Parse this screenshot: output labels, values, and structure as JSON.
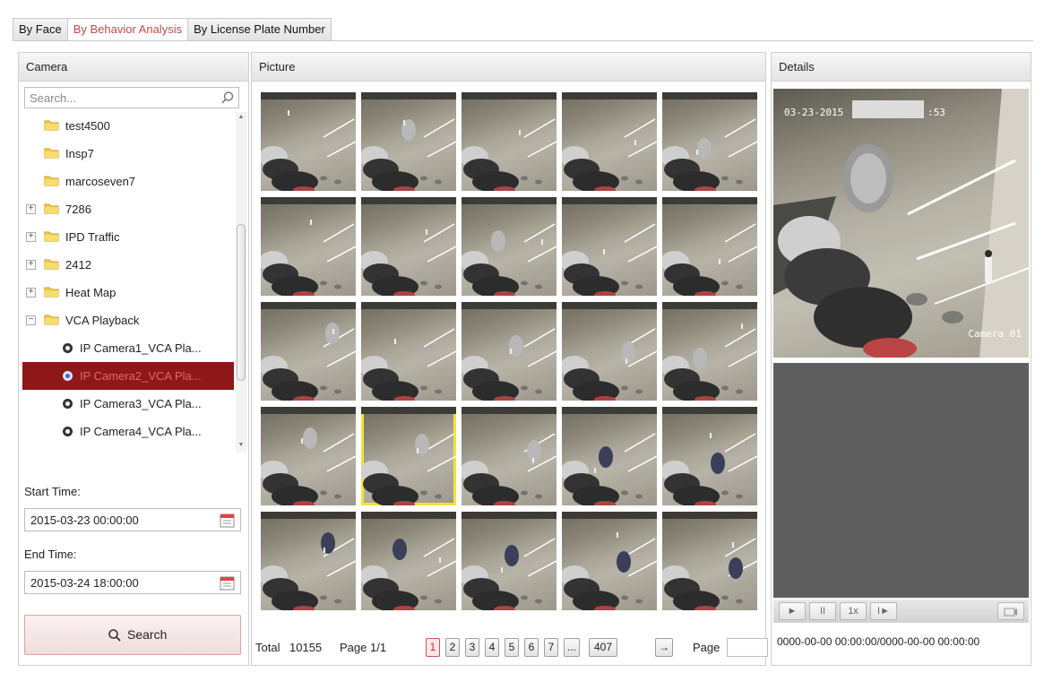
{
  "tabs": [
    {
      "label": "By Face"
    },
    {
      "label": "By Behavior Analysis"
    },
    {
      "label": "By License Plate Number"
    }
  ],
  "camera_panel": {
    "title": "Camera",
    "search_placeholder": "Search...",
    "tree": [
      {
        "label": "test4500",
        "type": "folder"
      },
      {
        "label": "Insp7",
        "type": "folder"
      },
      {
        "label": "marcoseven7",
        "type": "folder"
      },
      {
        "label": "7286",
        "type": "folder",
        "expander": "+"
      },
      {
        "label": "IPD Traffic",
        "type": "folder",
        "expander": "+"
      },
      {
        "label": "2412",
        "type": "folder",
        "expander": "+"
      },
      {
        "label": "Heat Map",
        "type": "folder",
        "expander": "+"
      },
      {
        "label": "VCA Playback",
        "type": "folder",
        "expander": "−"
      },
      {
        "label": "IP Camera1_VCA Pla...",
        "type": "camera"
      },
      {
        "label": "IP Camera2_VCA Pla...",
        "type": "camera",
        "selected": true
      },
      {
        "label": "IP Camera3_VCA Pla...",
        "type": "camera"
      },
      {
        "label": "IP Camera4_VCA Pla...",
        "type": "camera"
      }
    ],
    "start_time_label": "Start Time:",
    "start_time_value": "2015-03-23 00:00:00",
    "end_time_label": "End Time:",
    "end_time_value": "2015-03-24 18:00:00",
    "search_button": "Search"
  },
  "picture_panel": {
    "title": "Picture",
    "thumbnail_count": 25,
    "selected_thumbnail": 16,
    "pager": {
      "total_label": "Total",
      "total_value": "10155",
      "page_info": "Page 1/1",
      "pages": [
        "1",
        "2",
        "3",
        "4",
        "5",
        "6",
        "7",
        "...",
        "407"
      ],
      "current_page": "1",
      "next_arrow": "→",
      "page_label": "Page"
    }
  },
  "details_panel": {
    "title": "Details",
    "osd_date": "03-23-2015",
    "osd_time_tail": ":53",
    "osd_camera": "Camera 01",
    "controls": {
      "play": "►",
      "pause": "II",
      "speed": "1x",
      "step": "I►"
    },
    "time_range": "0000-00-00 00:00:00/0000-00-00 00:00:00"
  },
  "colors": {
    "active_tab": "#c24b4b",
    "selected_row_bg": "#8e1717",
    "selected_thumb_border": "#f2e23a"
  }
}
